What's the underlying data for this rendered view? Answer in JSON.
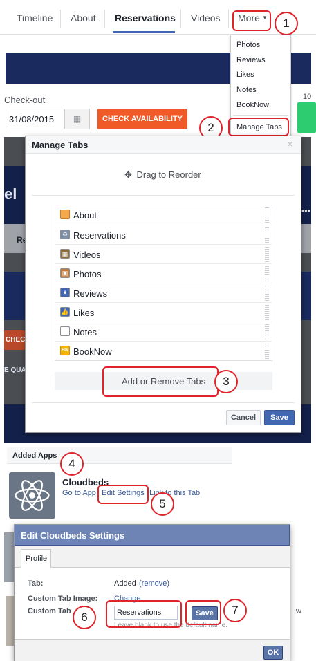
{
  "nav_tabs": [
    {
      "label": "Timeline"
    },
    {
      "label": "About"
    },
    {
      "label": "Reservations"
    },
    {
      "label": "Videos"
    },
    {
      "label": "More"
    }
  ],
  "more_dropdown": {
    "items": [
      "Photos",
      "Reviews",
      "Likes",
      "Notes",
      "BookNow"
    ],
    "manage_tabs": "Manage Tabs"
  },
  "booking": {
    "checkout_label": "Check-out",
    "checkout_date": "31/08/2015",
    "check_availability": "CHECK AVAILABILITY",
    "edge_number": "10"
  },
  "background_fragments": {
    "left_letter": "el",
    "tab_fragment": "Re",
    "check_fragment": "CHEC",
    "qual_fragment": "E QUAL"
  },
  "manage_tabs_dialog": {
    "title": "Manage Tabs",
    "drag_hint": "Drag to Reorder",
    "tabs": [
      {
        "label": "About",
        "icon": "about-icon"
      },
      {
        "label": "Reservations",
        "icon": "gear-icon"
      },
      {
        "label": "Videos",
        "icon": "film-icon"
      },
      {
        "label": "Photos",
        "icon": "photo-icon"
      },
      {
        "label": "Reviews",
        "icon": "star-icon"
      },
      {
        "label": "Likes",
        "icon": "thumbs-up-icon"
      },
      {
        "label": "Notes",
        "icon": "note-icon"
      },
      {
        "label": "BookNow",
        "icon": "booknow-icon"
      }
    ],
    "add_remove": "Add or Remove Tabs",
    "cancel": "Cancel",
    "save": "Save"
  },
  "added_apps": {
    "heading": "Added Apps",
    "app_name": "Cloudbeds",
    "go_to_app": "Go to App",
    "edit_settings": "Edit Settings",
    "link_to_tab": "Link to this Tab"
  },
  "edit_settings_dialog": {
    "title": "Edit Cloudbeds Settings",
    "profile_tab": "Profile",
    "tab_label": "Tab:",
    "tab_value": "Added",
    "remove_link": "(remove)",
    "custom_image_label": "Custom Tab Image:",
    "change_link": "Change",
    "custom_name_label": "Custom Tab",
    "custom_name_value": "Reservations",
    "save": "Save",
    "hint": "Leave blank to use the default name.",
    "ok": "OK",
    "edge_letter": "w"
  },
  "annotations": [
    "1",
    "2",
    "3",
    "4",
    "5",
    "6",
    "7"
  ],
  "colors": {
    "accent_red": "#e0242b",
    "fb_blue": "#3b5998",
    "orange": "#f05a28",
    "green": "#2ecc71",
    "navy": "#1a2a5e"
  }
}
